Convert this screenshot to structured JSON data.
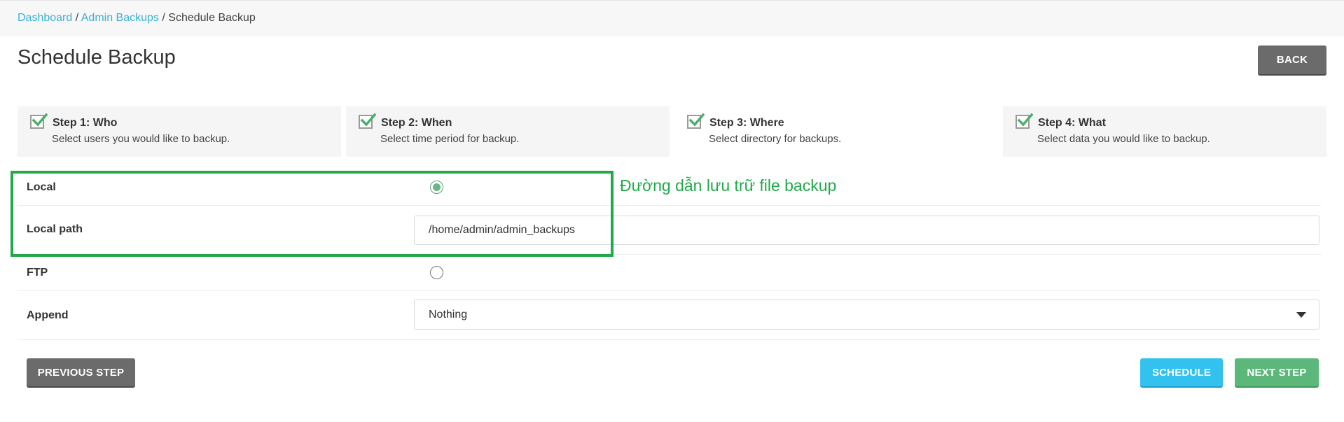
{
  "breadcrumb": {
    "items": [
      "Dashboard",
      "Admin Backups"
    ],
    "separator": "/",
    "current": "Schedule Backup"
  },
  "page_title": "Schedule Backup",
  "back_label": "BACK",
  "steps": [
    {
      "title": "Step 1: Who",
      "desc": "Select users you would like to backup.",
      "checked": true
    },
    {
      "title": "Step 2: When",
      "desc": "Select time period for backup.",
      "checked": true
    },
    {
      "title": "Step 3: Where",
      "desc": "Select directory for backups.",
      "checked": true,
      "active": true
    },
    {
      "title": "Step 4: What",
      "desc": "Select data you would like to backup.",
      "checked": true
    }
  ],
  "form": {
    "local_label": "Local",
    "local_selected": true,
    "local_path_label": "Local path",
    "local_path_value": "/home/admin/admin_backups",
    "ftp_label": "FTP",
    "ftp_selected": false,
    "append_label": "Append",
    "append_value": "Nothing"
  },
  "annotation_text": "Đường dẫn lưu trữ file backup",
  "buttons": {
    "previous": "PREVIOUS STEP",
    "schedule": "SCHEDULE",
    "next": "NEXT STEP"
  },
  "colors": {
    "link": "#3bb0d8",
    "annotation_green": "#22a94a",
    "schedule_blue": "#33c2f0",
    "next_green": "#5cb87a",
    "gray_button": "#6b6b6b"
  }
}
